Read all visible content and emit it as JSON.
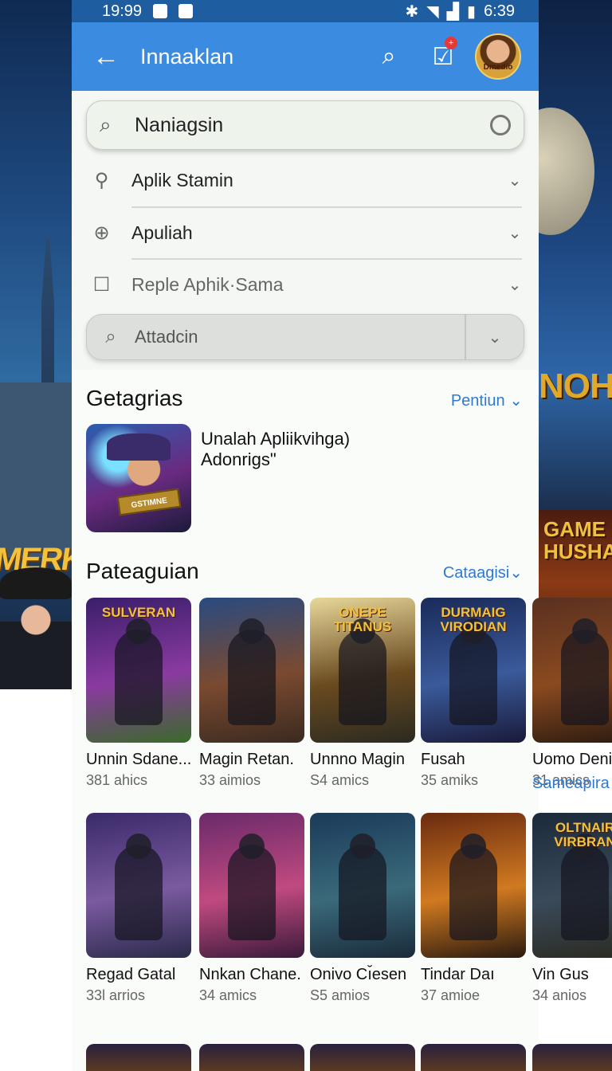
{
  "statusbar": {
    "time_left": "19:99",
    "time_right": "6:39"
  },
  "appbar": {
    "title": "Innaaklan",
    "avatar_label": "Dmedio"
  },
  "search": {
    "value": "Naniagsin"
  },
  "filters": [
    {
      "label": "Aplik Stamin",
      "icon": "location-pin-icon"
    },
    {
      "label": "Apuliah",
      "icon": "zoom-icon"
    },
    {
      "label": "Reple Aphik·Sama",
      "icon": "checkbox-icon"
    }
  ],
  "filterbar": {
    "placeholder": "Attadcin"
  },
  "categories": {
    "title": "Getagrias",
    "link": "Pentiun ⌄",
    "featured_line1": "Unalah Apliikvihga)",
    "featured_line2": "Adonrigs\"",
    "featured_badge": "GSTIMNE"
  },
  "popular": {
    "title": "Pateaguian",
    "link": "Cataagisi⌄",
    "side_link": "Sameapira"
  },
  "background": {
    "left_text": "MERK",
    "right_text": "NOH",
    "right_poster": "GAME HUSHAS"
  },
  "games_row1": [
    {
      "name": "Unnin Sdane...",
      "sub": "381 ahics",
      "art": "SULVERAN",
      "colors": [
        "#3a1e6a",
        "#8a3aa0",
        "#3a6a2a"
      ]
    },
    {
      "name": "Magin Retan.",
      "sub": "33 aimios",
      "art": "",
      "colors": [
        "#2a4a80",
        "#7a4a30",
        "#3a2a20"
      ]
    },
    {
      "name": "Unnno Magin",
      "sub": "S4 amics",
      "art": "ONEPE TITANUS",
      "colors": [
        "#e8d89a",
        "#6a4a20",
        "#2a2a20"
      ]
    },
    {
      "name": "Fusah",
      "sub": "35 amiks",
      "art": "DURMAIG VIRODIAN",
      "colors": [
        "#1a2a5a",
        "#3a5a9a",
        "#1a1a3a"
      ]
    },
    {
      "name": "Uomo Denia",
      "sub": "31 amics",
      "art": "",
      "colors": [
        "#5a3020",
        "#8a4a20",
        "#2a1a10"
      ]
    }
  ],
  "games_row2": [
    {
      "name": "Regad Gatal",
      "sub": "33l arrios",
      "art": "",
      "colors": [
        "#3a2a6a",
        "#7a5aa0",
        "#2a2a4a"
      ]
    },
    {
      "name": "Nnkan Chane.",
      "sub": "34 amics",
      "art": "",
      "colors": [
        "#6a2a6a",
        "#c04a80",
        "#3a1a3a"
      ]
    },
    {
      "name": "Onivo Cı̆esen",
      "sub": "S5 amios",
      "art": "",
      "colors": [
        "#1a3a5a",
        "#3a6a7a",
        "#1a2a3a"
      ]
    },
    {
      "name": "Tindar Daı",
      "sub": "37 amioe",
      "art": "",
      "colors": [
        "#6a2a10",
        "#d07a20",
        "#2a1a10"
      ]
    },
    {
      "name": "Vin Gus",
      "sub": "34 anios",
      "art": "OLTNAIR VIRBRAN",
      "colors": [
        "#1a2a3a",
        "#3a4a5a",
        "#2a2a20"
      ]
    }
  ]
}
